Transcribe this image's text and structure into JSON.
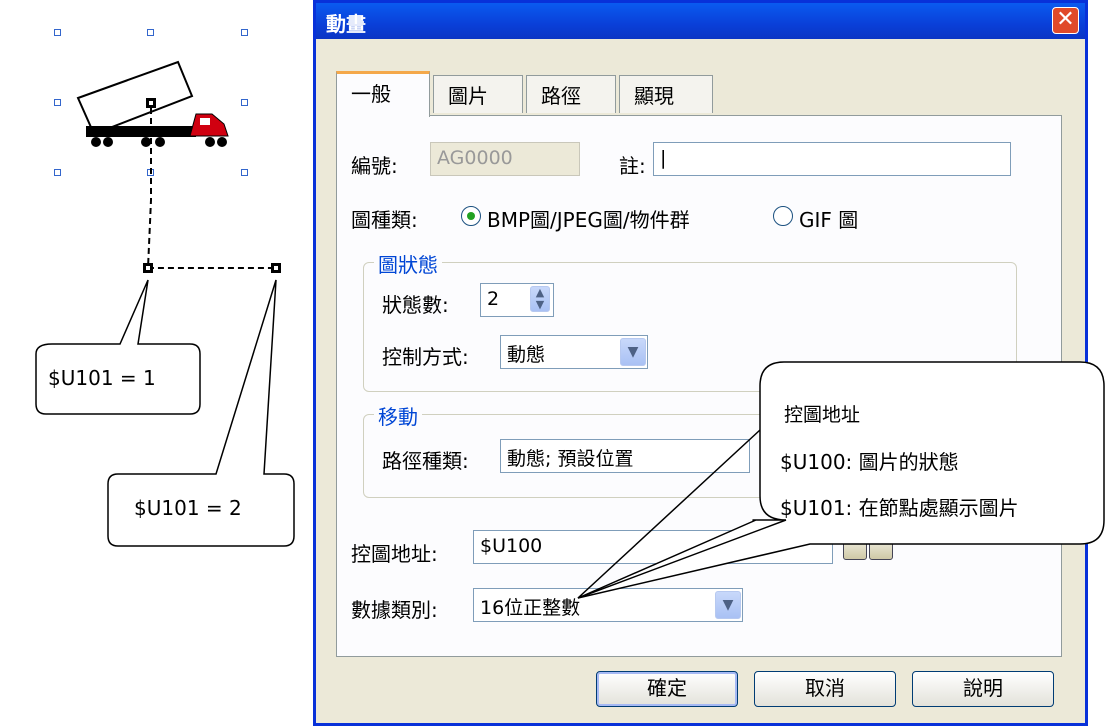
{
  "dialog": {
    "title": "動畫",
    "close_glyph": "✕",
    "tabs": [
      "一般",
      "圖片",
      "路徑",
      "顯現"
    ],
    "id_label": "編號:",
    "id_value": "AG0000",
    "note_label": "註:",
    "note_value": "|",
    "pic_type_label": "圖種類:",
    "pic_type_options": [
      "BMP圖/JPEG圖/物件群",
      "GIF 圖"
    ],
    "pic_type_selected": "BMP圖/JPEG圖/物件群",
    "state_group": {
      "title": "圖狀態",
      "count_label": "狀態數:",
      "count_value": "2",
      "control_label": "控制方式:",
      "control_value": "動態"
    },
    "move_group": {
      "title": "移動",
      "path_label": "路徑種類:",
      "path_value": "動態; 預設位置"
    },
    "address_label": "控圖地址:",
    "address_value": "$U100",
    "datatype_label": "數據類別:",
    "datatype_value": "16位正整數",
    "buttons": {
      "ok": "確定",
      "cancel": "取消",
      "help": "說明"
    }
  },
  "annotations": {
    "node1": "$U101 = 1",
    "node2": "$U101 = 2",
    "address_callout": {
      "title": "控圖地址",
      "line1": "$U100: 圖片的狀態",
      "line2": "$U101: 在節點處顯示圖片"
    }
  },
  "colors": {
    "titlebar": "#0a4be0",
    "close": "#e04a2a",
    "group_title": "#0046d5",
    "accent_tab": "#f4a84a"
  }
}
